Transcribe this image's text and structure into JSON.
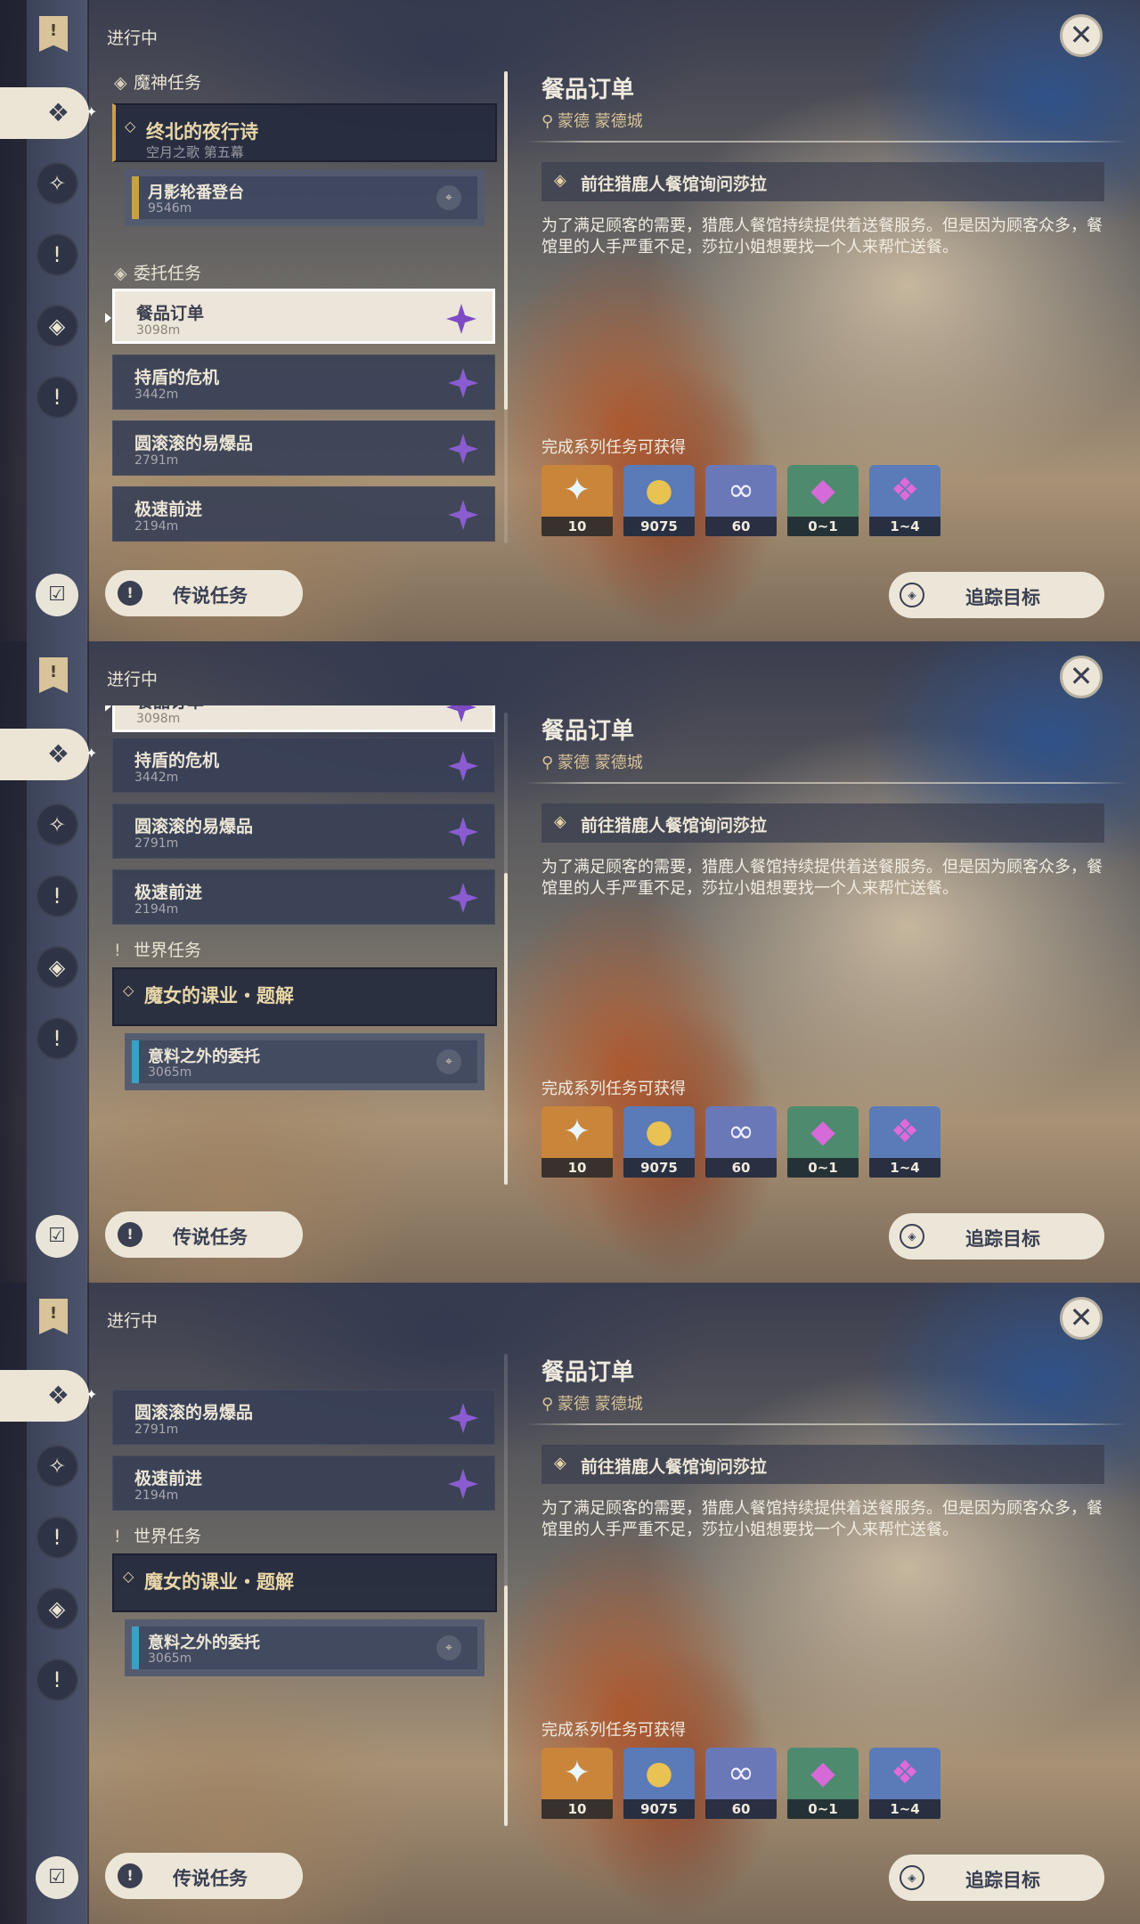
{
  "header": {
    "status": "进行中"
  },
  "categories": {
    "archon": "魔神任务",
    "commission": "委托任务",
    "world": "世界任务"
  },
  "quests": {
    "archon_main": {
      "title": "终北的夜行诗",
      "subtitle": "空月之歌 第五幕"
    },
    "archon_sub": {
      "title": "月影轮番登台",
      "distance": "9546m"
    },
    "commissions": [
      {
        "title": "餐品订单",
        "distance": "3098m"
      },
      {
        "title": "持盾的危机",
        "distance": "3442m"
      },
      {
        "title": "圆滚滚的易爆品",
        "distance": "2791m"
      },
      {
        "title": "极速前进",
        "distance": "2194m"
      }
    ],
    "world_main": {
      "title": "魔女的课业・题解"
    },
    "world_sub": {
      "title": "意料之外的委托",
      "distance": "3065m"
    }
  },
  "detail": {
    "title": "餐品订单",
    "location": "蒙德 蒙德城",
    "objective": "前往猎鹿人餐馆询问莎拉",
    "description": "为了满足顾客的需要，猎鹿人餐馆持续提供着送餐服务。但是因为顾客众多，餐馆里的人手严重不足，莎拉小姐想要找一个人来帮忙送餐。",
    "rewards_heading": "完成系列任务可获得",
    "rewards": [
      {
        "icon": "primogem-icon",
        "qty": "10",
        "color": "#c9853a"
      },
      {
        "icon": "mora-icon",
        "qty": "9075",
        "color": "#5a7ab8"
      },
      {
        "icon": "companionship-exp-icon",
        "qty": "60",
        "color": "#6a78b8"
      },
      {
        "icon": "crystal-chunk-icon",
        "qty": "0~1",
        "color": "#4e8a6e"
      },
      {
        "icon": "crystal-cluster-icon",
        "qty": "1~4",
        "color": "#5a7ab8"
      }
    ]
  },
  "buttons": {
    "legend": "传说任务",
    "track": "追踪目标"
  },
  "colors": {
    "accent_gold": "#c9a04a",
    "world_bar": "#3aa0c8",
    "gem_purple": "#8a5cd0",
    "panel_light": "#ece6d8"
  }
}
